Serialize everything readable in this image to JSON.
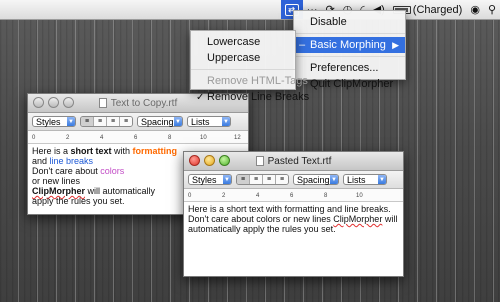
{
  "menubar": {
    "items": [
      {
        "name": "clipmorpher",
        "glyph": "⇄"
      },
      {
        "name": "dots",
        "glyph": "···"
      },
      {
        "name": "sync",
        "glyph": "⟳"
      },
      {
        "name": "time-machine",
        "glyph": "◷"
      },
      {
        "name": "wifi",
        "glyph": "◜"
      },
      {
        "name": "volume",
        "glyph": "◀)"
      },
      {
        "name": "battery_status",
        "text": "(Charged)"
      },
      {
        "name": "user",
        "glyph": "◉"
      },
      {
        "name": "spotlight",
        "glyph": "⚲"
      }
    ],
    "battery_status": "(Charged)"
  },
  "main_menu": {
    "items": [
      "Disable",
      "Basic Morphing",
      "Preferences...",
      "Quit ClipMorpher"
    ]
  },
  "submenu": {
    "items": [
      "Lowercase",
      "Uppercase",
      "Remove HTML-Tags",
      "Remove Line Breaks"
    ]
  },
  "window1": {
    "title": "Text to Copy.rtf",
    "toolbar": {
      "styles": "Styles",
      "spacing": "Spacing",
      "lists": "Lists"
    },
    "ruler_labels": [
      "0",
      "2",
      "4",
      "6",
      "8",
      "10",
      "12"
    ],
    "lines": {
      "l1a": "Here is a ",
      "l1b": "short text",
      "l1c": " with ",
      "l1d": "formatting",
      "l2a": "and ",
      "l2b": "line breaks",
      "l3a": "Don't care about ",
      "l3b": "colors",
      "l4": "or new lines",
      "l5a": "ClipMorpher",
      "l5b": " will automatically",
      "l6": "apply the rules you set."
    }
  },
  "window2": {
    "title": "Pasted Text.rtf",
    "toolbar": {
      "styles": "Styles",
      "spacing": "Spacing",
      "lists": "Lists"
    },
    "ruler_labels": [
      "0",
      "2",
      "4",
      "6",
      "8",
      "10"
    ],
    "text_a": "Here is a short text with formatting and line breaks. Don't care about colors or new lines ",
    "text_b": "ClipMorpher",
    "text_c": " will automatically apply the rules you set."
  },
  "colors": {
    "highlight": "#3470e0",
    "formatting": "#ff6a00",
    "line_breaks": "#1e5ad6",
    "colors_word": "#c24dc6"
  }
}
